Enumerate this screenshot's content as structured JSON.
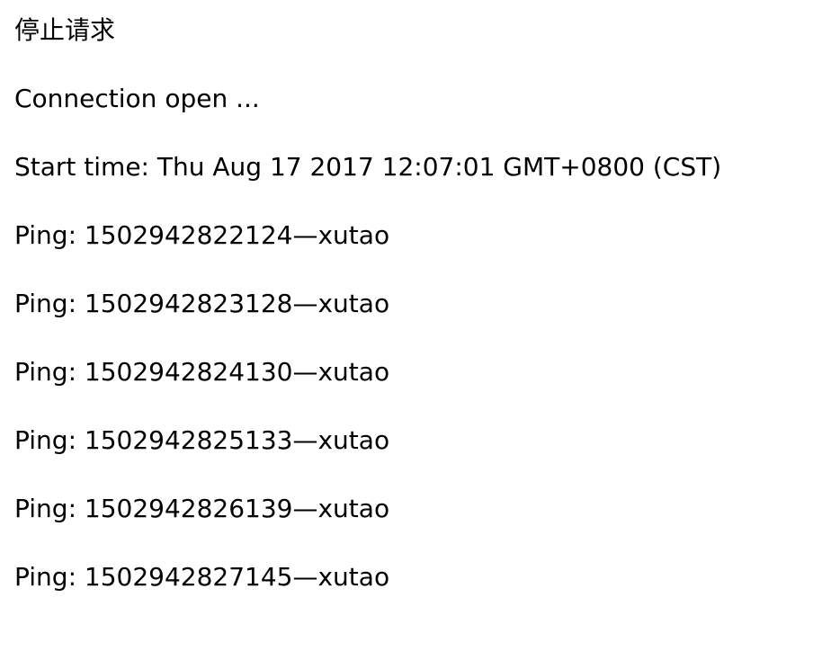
{
  "stop_request_label": "停止请求",
  "log": {
    "lines": [
      "Connection open ...",
      "Start time: Thu Aug 17 2017 12:07:01 GMT+0800 (CST)",
      "Ping: 1502942822124—xutao",
      "Ping: 1502942823128—xutao",
      "Ping: 1502942824130—xutao",
      "Ping: 1502942825133—xutao",
      "Ping: 1502942826139—xutao",
      "Ping: 1502942827145—xutao"
    ]
  }
}
